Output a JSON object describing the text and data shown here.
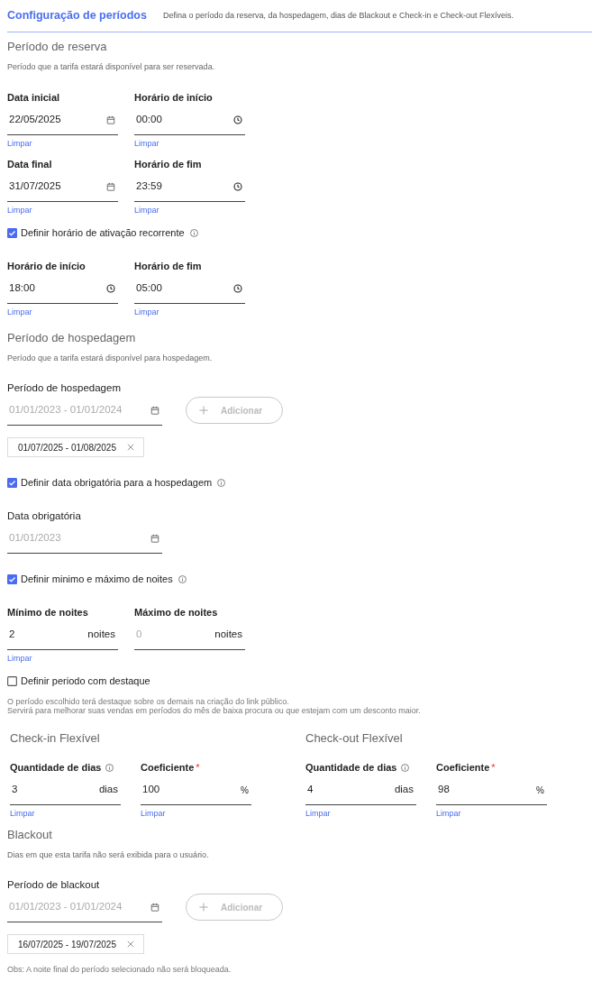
{
  "header": {
    "title": "Configuração de períodos",
    "description": "Defina o período da reserva, da hospedagem, dias de Blackout e Check-in e Check-out Flexíveis."
  },
  "blocks": [
    {
      "kind": "section",
      "title": "Período de reserva",
      "description": "Período que a tarifa estará disponível para ser reservada."
    },
    {
      "kind": "fields",
      "fields": [
        {
          "kind": "date",
          "label": "Data inicial",
          "value": "22/05/2025",
          "clear": "Limpar"
        },
        {
          "kind": "time",
          "label": "Horário de início",
          "value": "00:00",
          "clear": "Limpar"
        }
      ]
    },
    {
      "kind": "fields",
      "fields": [
        {
          "kind": "date",
          "label": "Data final",
          "value": "31/07/2025",
          "clear": "Limpar"
        },
        {
          "kind": "time",
          "label": "Horário de fim",
          "value": "23:59",
          "clear": "Limpar"
        }
      ]
    },
    {
      "kind": "checkbox",
      "label": "Definir horário de ativação recorrente",
      "checked": true,
      "info": true
    },
    {
      "kind": "fields",
      "fields": [
        {
          "kind": "time",
          "label": "Horário de início",
          "value": "18:00",
          "clear": "Limpar"
        },
        {
          "kind": "time",
          "label": "Horário de fim",
          "value": "05:00",
          "clear": "Limpar"
        }
      ]
    },
    {
      "kind": "section",
      "title": "Período de hospedagem",
      "description": "Período que a tarifa estará disponível para hospedagem."
    },
    {
      "kind": "range",
      "label": "Período de hospedagem",
      "placeholder": "01/01/2023 - 01/01/2024",
      "button": "Adicionar",
      "chips": [
        "01/07/2025 - 01/08/2025"
      ]
    },
    {
      "kind": "checkbox",
      "label": "Definir data obrigatória para a hospedagem",
      "checked": true,
      "info": true
    },
    {
      "kind": "date",
      "label": "Data obrigatória",
      "placeholder": "01/01/2023"
    },
    {
      "kind": "checkbox",
      "label": "Definir minimo e máximo de noites",
      "checked": true,
      "info": true
    },
    {
      "kind": "fields",
      "fields": [
        {
          "kind": "number",
          "label": "Mínimo de noites",
          "value": "2",
          "suffix": "noites",
          "clear": "Limpar"
        },
        {
          "kind": "number",
          "label": "Máximo de noites",
          "placeholder": "0",
          "suffix": "noites"
        }
      ]
    },
    {
      "kind": "checkbox",
      "label": "Definir periodo com destaque",
      "checked": false
    },
    {
      "kind": "note",
      "lines": [
        "O período escolhido terá destaque sobre os demais na criação do link público.",
        "Servirá para melhorar suas vendas em períodos do mês de baixa procura ou que estejam com um desconto maior."
      ]
    },
    {
      "kind": "columns",
      "columns": [
        {
          "title": "Check-in Flexível",
          "fields": [
            {
              "kind": "number",
              "label": "Quantidade de dias",
              "info": true,
              "value": "3",
              "suffix": "dias",
              "clear": "Limpar"
            },
            {
              "kind": "number",
              "label": "Coeficiente",
              "required_mark": "*",
              "value": "100",
              "suffix": "%",
              "clear": "Limpar"
            }
          ]
        },
        {
          "title": "Check-out Flexível",
          "fields": [
            {
              "kind": "number",
              "label": "Quantidade de dias",
              "info": true,
              "value": "4",
              "suffix": "dias",
              "clear": "Limpar"
            },
            {
              "kind": "number",
              "label": "Coeficiente",
              "required_mark": "*",
              "value": "98",
              "suffix": "%",
              "clear": "Limpar"
            }
          ]
        }
      ]
    },
    {
      "kind": "section",
      "title": "Blackout",
      "description": "Dias em que esta tarifa não será exibida para o usuário."
    },
    {
      "kind": "range",
      "label": "Período de blackout",
      "placeholder": "01/01/2023 - 01/01/2024",
      "button": "Adicionar",
      "chips": [
        "16/07/2025 - 19/07/2025"
      ]
    },
    {
      "kind": "note",
      "lines": [
        "Obs: A noite final do período selecionado não será bloqueada."
      ]
    }
  ]
}
